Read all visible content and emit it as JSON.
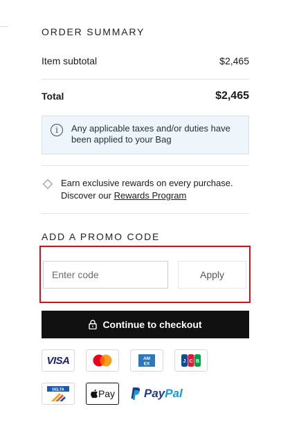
{
  "order_summary": {
    "title": "ORDER SUMMARY",
    "subtotal_label": "Item subtotal",
    "subtotal_value": "$2,465",
    "total_label": "Total",
    "total_value": "$2,465"
  },
  "tax_notice": {
    "icon": "info-icon",
    "text": "Any applicable taxes and/or duties have been applied to your Bag"
  },
  "rewards": {
    "text_before": "Earn exclusive rewards on every purchase. Discover our ",
    "link_label": "Rewards Program"
  },
  "promo": {
    "title": "ADD A PROMO CODE",
    "placeholder": "Enter code",
    "value": "",
    "apply_label": "Apply"
  },
  "checkout": {
    "label": "Continue to checkout",
    "icon": "lock-icon"
  },
  "payment_methods": {
    "visa": "VISA",
    "mastercard": "mastercard",
    "amex": "AMEX",
    "jcb": "JCB",
    "delta": "DELTA",
    "apple_pay": "Pay",
    "paypal_a": "Pay",
    "paypal_b": "Pal"
  },
  "colors": {
    "highlight_frame": "#d6101a",
    "checkout_bg": "#111111",
    "info_bg": "#eef6fb"
  }
}
